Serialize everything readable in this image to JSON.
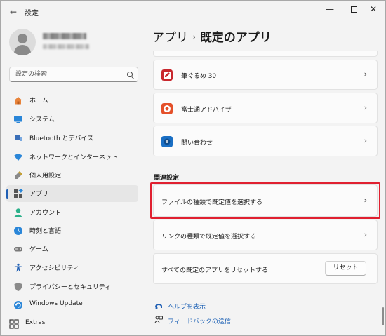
{
  "window": {
    "title": "設定"
  },
  "profile": {
    "name": "",
    "email": ""
  },
  "search": {
    "placeholder": "設定の検索"
  },
  "nav": {
    "items": [
      {
        "label": "ホーム",
        "icon": "home-icon"
      },
      {
        "label": "システム",
        "icon": "system-icon"
      },
      {
        "label": "Bluetooth とデバイス",
        "icon": "bluetooth-icon"
      },
      {
        "label": "ネットワークとインターネット",
        "icon": "network-icon"
      },
      {
        "label": "個人用設定",
        "icon": "personalization-icon"
      },
      {
        "label": "アプリ",
        "icon": "apps-icon",
        "selected": true
      },
      {
        "label": "アカウント",
        "icon": "account-icon"
      },
      {
        "label": "時刻と言語",
        "icon": "time-language-icon"
      },
      {
        "label": "ゲーム",
        "icon": "gaming-icon"
      },
      {
        "label": "アクセシビリティ",
        "icon": "accessibility-icon"
      },
      {
        "label": "プライバシーとセキュリティ",
        "icon": "privacy-icon"
      },
      {
        "label": "Windows Update",
        "icon": "windows-update-icon"
      }
    ],
    "extras": {
      "label": "Extras",
      "icon": "extras-icon"
    }
  },
  "breadcrumb": {
    "parent": "アプリ",
    "separator": "›",
    "current": "既定のアプリ"
  },
  "app_list": [
    {
      "label": "筆ぐるめ 30",
      "icon": "fudegurume-icon",
      "color": "#c8282e"
    },
    {
      "label": "富士通アドバイザー",
      "icon": "fujitsu-advisor-icon",
      "color": "#e4502a"
    },
    {
      "label": "問い合わせ",
      "icon": "contact-icon",
      "color": "#1a6fc4"
    }
  ],
  "related": {
    "title": "関連設定",
    "file_type": "ファイルの種類で既定値を選択する",
    "link_type": "リンクの種類で既定値を選択する",
    "reset_label": "すべての既定のアプリをリセットする",
    "reset_button": "リセット"
  },
  "footer_links": {
    "help": "ヘルプを表示",
    "feedback": "フィードバックの送信"
  },
  "colors": {
    "accent": "#1f5fb4",
    "highlight": "#e02030",
    "link": "#1a5fb4"
  }
}
